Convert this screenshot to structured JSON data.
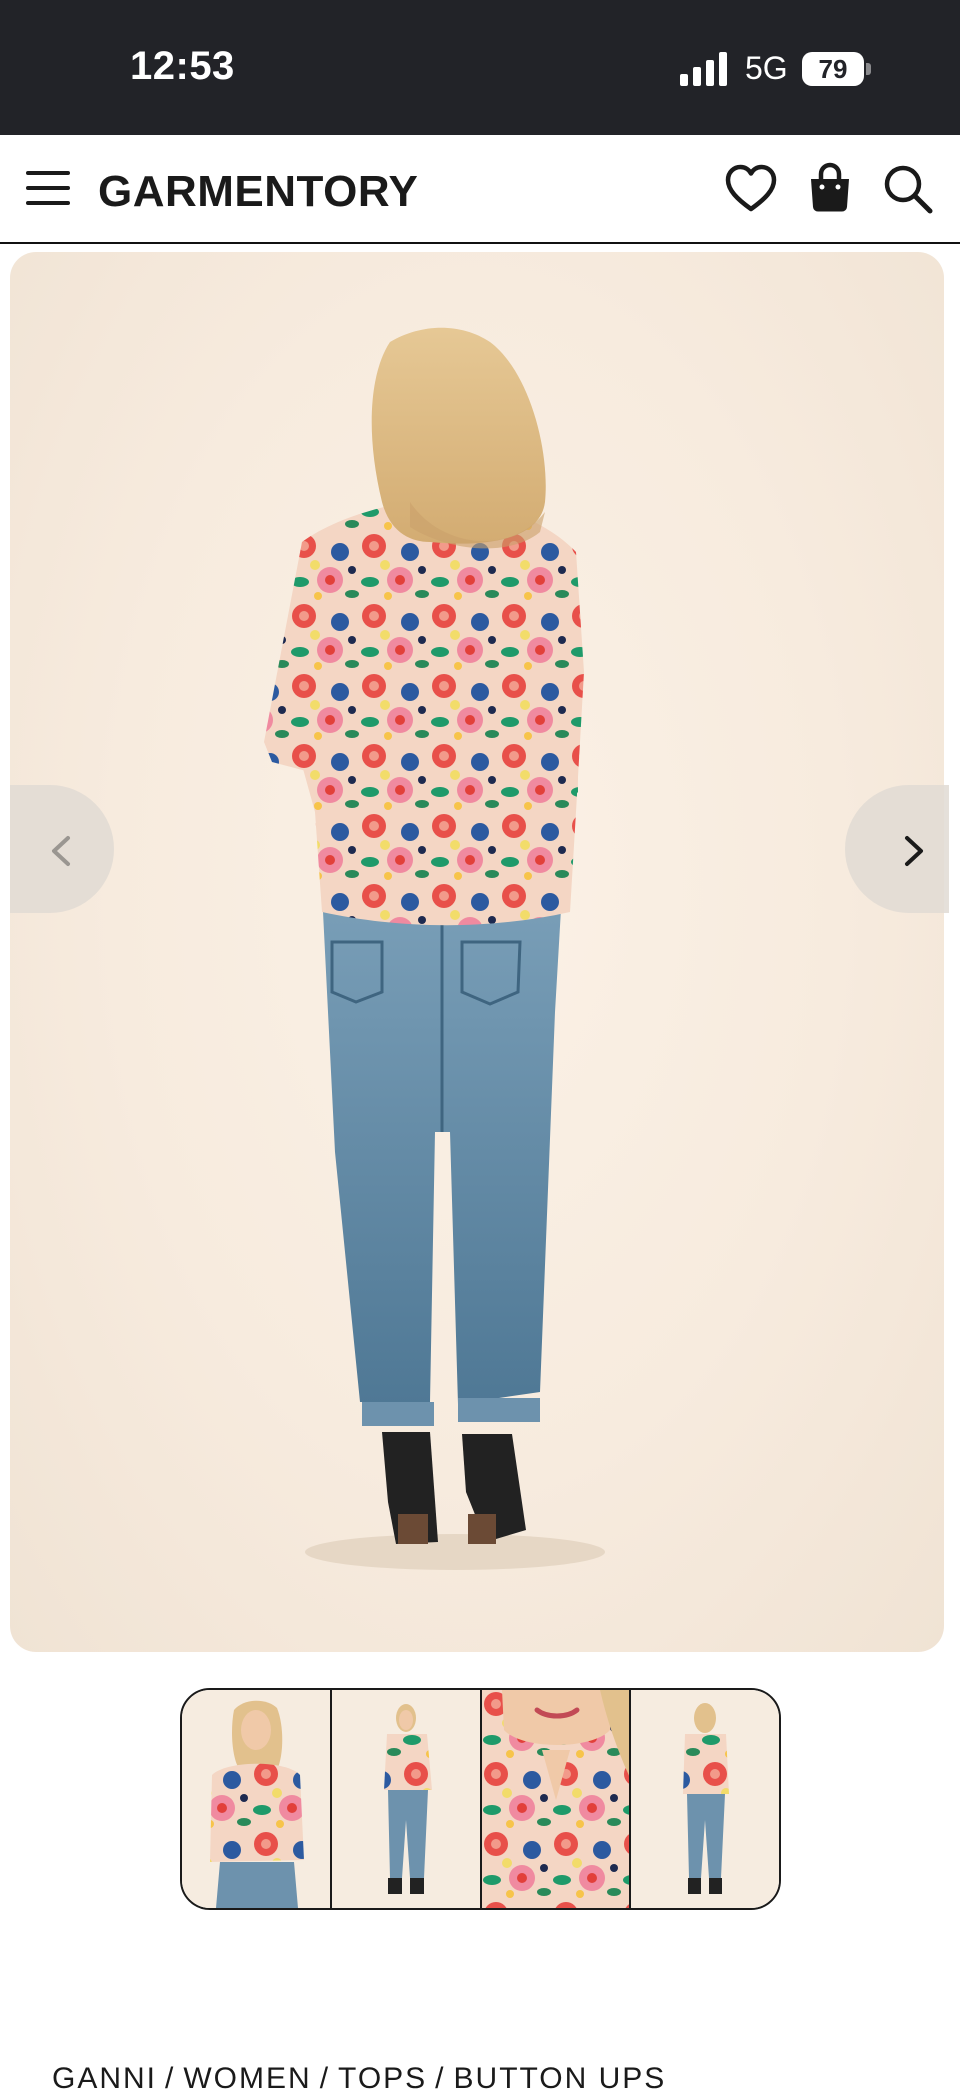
{
  "status_bar": {
    "time": "12:53",
    "network": "5G",
    "battery": "79"
  },
  "header": {
    "logo": "GARMENTORY",
    "icons": [
      "menu-icon",
      "heart-icon",
      "shopping-bag-icon",
      "search-icon"
    ]
  },
  "gallery": {
    "main_image": "model-back-view-floral-shirt",
    "thumbnails": [
      "model-front-floral-shirt",
      "model-full-body-front",
      "model-closeup-collar",
      "model-full-body-back"
    ]
  },
  "breadcrumb": {
    "items": [
      "GANNI",
      "WOMEN",
      "TOPS",
      "BUTTON UPS"
    ],
    "separator": "/"
  },
  "colors": {
    "status_bar_bg": "#222328",
    "text": "#1a1a1a",
    "image_bg": "#f7ebde"
  }
}
